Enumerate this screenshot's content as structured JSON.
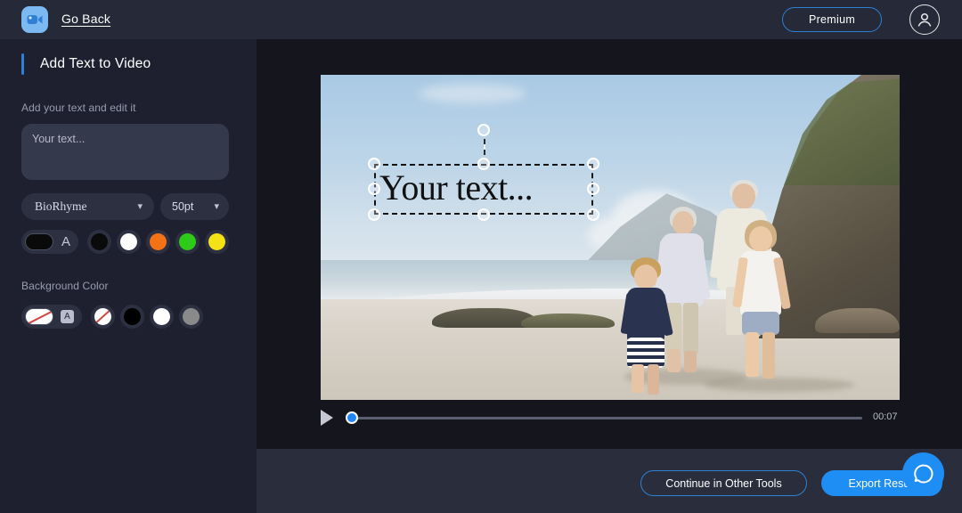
{
  "header": {
    "logo_icon": "video-camera-icon",
    "go_back_label": "Go Back",
    "premium_label": "Premium",
    "avatar_icon": "user-avatar-icon"
  },
  "sidebar": {
    "panel_title": "Add Text to Video",
    "text_section_label": "Add your text and edit it",
    "text_input_placeholder": "Your text...",
    "text_input_value": "",
    "font_name": "BioRhyme",
    "font_size": "50pt",
    "chevron_icon": "chevron-down-icon",
    "text_colors": {
      "selected_label": "A",
      "selected_color": "#0a0a0a",
      "swatches": [
        "#0a0a0a",
        "#ffffff",
        "#f47216",
        "#2ecc18",
        "#f5e216"
      ]
    },
    "background_section_label": "Background Color",
    "background_colors": {
      "selected_label": "A",
      "selected_color": "none",
      "swatches": [
        "none",
        "#000000",
        "#ffffff",
        "#8a8a8a"
      ]
    }
  },
  "stage": {
    "overlay_text": "Your text...",
    "handle_count": 8,
    "rotation_handle": "rotate-handle"
  },
  "player": {
    "play_icon": "play-icon",
    "progress_percent": 2,
    "duration": "00:07"
  },
  "footer": {
    "continue_label": "Continue in Other Tools",
    "export_label": "Export Result",
    "help_icon": "help-chat-icon"
  },
  "colors": {
    "accent": "#2f7fd4",
    "primary_blue": "#1e8ef5",
    "sidebar_bg": "#1e2030",
    "header_bg": "#262937",
    "stage_bg": "#15161d",
    "footer_bg": "#2a2d3c"
  }
}
